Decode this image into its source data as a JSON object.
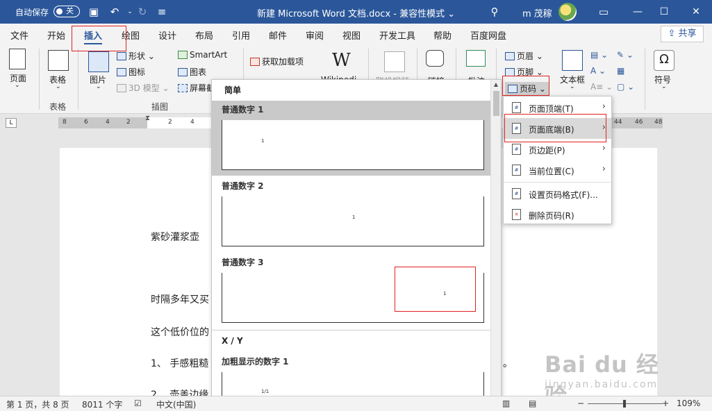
{
  "titlebar": {
    "autosave_label": "自动保存",
    "autosave_state": "关",
    "doc_title": "新建 Microsoft Word 文档.docx  -  兼容性模式 ⌄",
    "user_name": "m 茂稼"
  },
  "tabs": [
    {
      "label": "文件"
    },
    {
      "label": "开始"
    },
    {
      "label": "插入"
    },
    {
      "label": "绘图"
    },
    {
      "label": "设计"
    },
    {
      "label": "布局"
    },
    {
      "label": "引用"
    },
    {
      "label": "邮件"
    },
    {
      "label": "审阅"
    },
    {
      "label": "视图"
    },
    {
      "label": "开发工具"
    },
    {
      "label": "帮助"
    },
    {
      "label": "百度网盘"
    }
  ],
  "share_label": "共享",
  "ribbon": {
    "page": "页面",
    "table": "表格",
    "picture": "图片",
    "shapes": "形状",
    "icons": "图标",
    "model3d": "3D 模型",
    "smartart": "SmartArt",
    "chart": "图表",
    "screenshot": "屏幕截",
    "addins": "获取加载项",
    "wiki": "Wikipedi",
    "video": "联机视频",
    "link": "链接",
    "comment": "批注",
    "header": "页眉",
    "footer": "页脚",
    "pagenum": "页码",
    "textbox": "文本框",
    "symbol": "符号",
    "group_table": "表格",
    "group_illustrations": "插图"
  },
  "ruler_numbers": [
    "8",
    "6",
    "4",
    "2",
    "2",
    "4",
    "44",
    "46",
    "48"
  ],
  "document": {
    "lines": [
      "紫砂灌浆壶",
      "时隔多年又买",
      "这个低价位的",
      "1、 手感粗糙",
      "2、 壶盖边缘"
    ],
    "trailing": "。"
  },
  "gallery": {
    "section_simple": "简单",
    "items": [
      {
        "label": "普通数字 1",
        "sample": "1"
      },
      {
        "label": "普通数字 2",
        "sample": "1"
      },
      {
        "label": "普通数字 3",
        "sample": "1"
      }
    ],
    "section_xy": "X / Y",
    "bold_label": "加粗显示的数字 1",
    "bold_sample": "1/1"
  },
  "submenu": {
    "items": [
      {
        "label": "页面顶端(T)"
      },
      {
        "label": "页面底端(B)"
      },
      {
        "label": "页边距(P)"
      },
      {
        "label": "当前位置(C)"
      },
      {
        "label": "设置页码格式(F)..."
      },
      {
        "label": "删除页码(R)"
      }
    ]
  },
  "statusbar": {
    "page": "第 1 页，共 8 页",
    "words": "8011 个字",
    "language": "中文(中国)",
    "zoom": "109%"
  },
  "watermark": {
    "main": "Bai du 经验",
    "sub": "jingyan.baidu.com"
  }
}
